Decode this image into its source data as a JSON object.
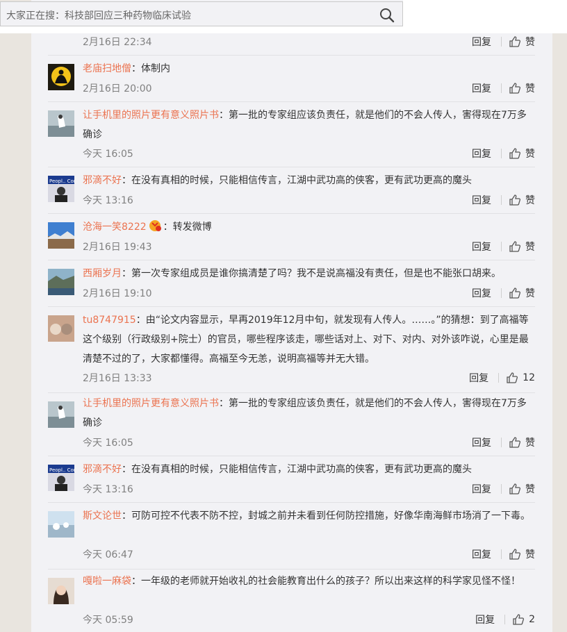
{
  "search": {
    "placeholder_text": "大家正在搜：科技部回应三种药物临床试验"
  },
  "actions": {
    "reply_label": "回复",
    "like_label": "赞"
  },
  "comments": [
    {
      "user": "",
      "text": "",
      "time": "2月16日 22:34",
      "likes": "赞"
    },
    {
      "user": "老庙扫地僧",
      "text": "：体制内",
      "time": "2月16日 20:00",
      "likes": "赞"
    },
    {
      "user": "让手机里的照片更有意义照片书",
      "text": "：第一批的专家组应该负责任，就是他们的不会人传人，害得现在7万多确诊",
      "time": "今天 16:05",
      "likes": "赞"
    },
    {
      "user": "邪滴不好",
      "text": "：在没有真相的时候，只能相信传言，江湖中武功高的侠客，更有武功更高的魔头",
      "time": "今天 13:16",
      "likes": "赞"
    },
    {
      "user": "沧海一笑8222",
      "text": "：转发微博",
      "time": "2月16日 19:43",
      "likes": "赞"
    },
    {
      "user": "西厢岁月",
      "text": "：第一次专家组成员是谁你搞清楚了吗？我不是说高福没有责任，但是也不能张口胡来。",
      "time": "2月16日 19:10",
      "likes": "赞"
    },
    {
      "user": "tu8747915",
      "text": "：由“论文内容显示，早再2019年12月中旬，就发现有人传人。……。”的猜想：到了高福等这个级别（行政级别+院士）的官员，哪些程序该走，哪些话对上、对下、对内、对外该咋说，心里是最清楚不过的了，大家都懂得。高福至今无恙，说明高福等并无大错。",
      "time": "2月16日 13:33",
      "likes": "12"
    },
    {
      "user": "让手机里的照片更有意义照片书",
      "text": "：第一批的专家组应该负责任，就是他们的不会人传人，害得现在7万多确诊",
      "time": "今天 16:05",
      "likes": "赞"
    },
    {
      "user": "邪滴不好",
      "text": "：在没有真相的时候，只能相信传言，江湖中武功高的侠客，更有武功更高的魔头",
      "time": "今天 13:16",
      "likes": "赞"
    },
    {
      "user": "斯文论世",
      "text": "：可防可控不代表不防不控，封城之前并未看到任何防控措施，好像华南海鲜市场消了一下毒。",
      "time": "今天 06:47",
      "likes": "赞"
    },
    {
      "user": "嘎啦一麻袋",
      "text": "：一年级的老师就开始收礼的社会能教育出什么的孩子？所以出来这样的科学家见怪不怪！",
      "time": "今天 05:59",
      "likes": "2"
    }
  ]
}
